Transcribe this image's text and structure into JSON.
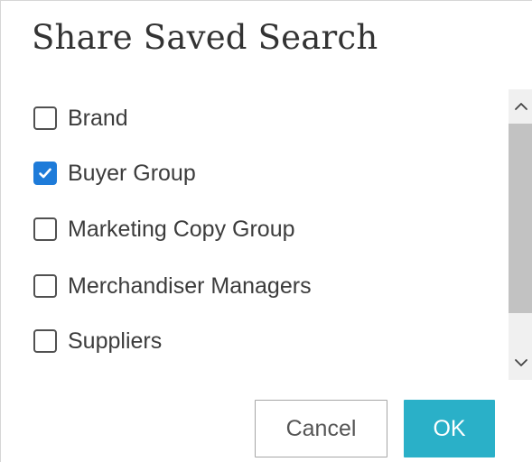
{
  "dialog": {
    "title": "Share Saved Search"
  },
  "options": [
    {
      "label": "Brand",
      "checked": false
    },
    {
      "label": "Buyer Group",
      "checked": true
    },
    {
      "label": "Marketing Copy Group",
      "checked": false
    },
    {
      "label": "Merchandiser Managers",
      "checked": false
    },
    {
      "label": "Suppliers",
      "checked": false
    }
  ],
  "scrollbar": {
    "up_icon": "chevron-up-icon",
    "down_icon": "chevron-down-icon"
  },
  "buttons": {
    "cancel_label": "Cancel",
    "ok_label": "OK"
  },
  "colors": {
    "checkbox_checked": "#1e7bd9",
    "ok_button": "#2ab0c8",
    "scroll_thumb": "#c2c2c2",
    "scroll_track": "#f0f0f0"
  }
}
